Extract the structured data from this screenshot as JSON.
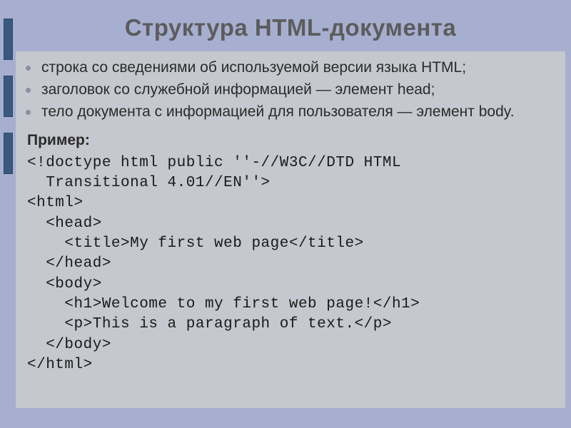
{
  "title": "Структура HTML-документа",
  "bullets": [
    "строка со сведениями об используемой версии языка HTML;",
    "заголовок со служебной информацией — элемент head;",
    "тело документа с информацией для пользователя — элемент body."
  ],
  "example_label": "Пример:",
  "code_lines": [
    "<!doctype html public ''-//W3C//DTD HTML",
    "  Transitional 4.01//EN''>",
    "<html>",
    "  <head>",
    "    <title>My first web page</title>",
    "  </head>",
    "  <body>",
    "    <h1>Welcome to my first web page!</h1>",
    "    <p>This is a paragraph of text.</p>",
    "  </body>",
    "</html>"
  ]
}
